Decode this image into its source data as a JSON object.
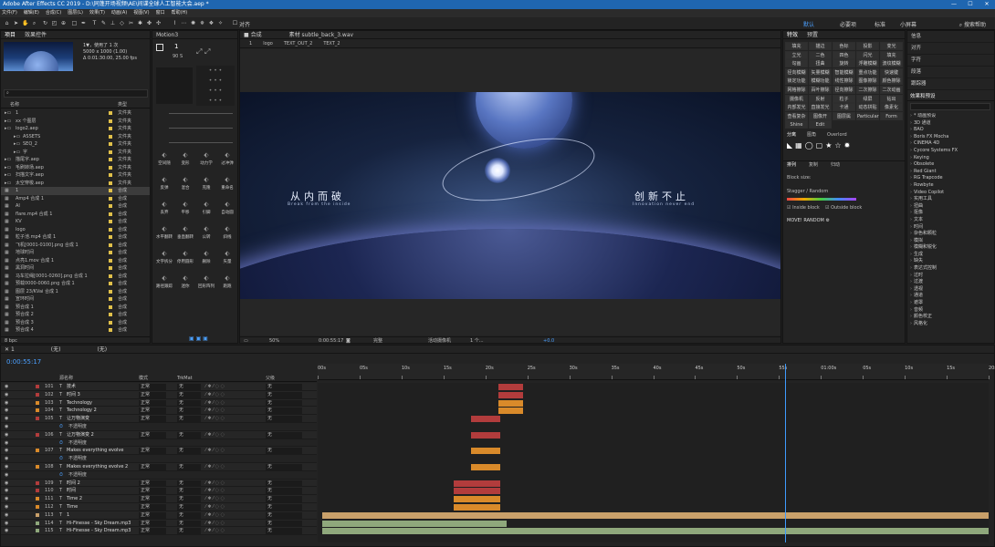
{
  "window": {
    "title": "Adobe After Effects CC 2019 - D:\\同蓬开场视频\\AE\\间谍全球人工智能大会.aep *"
  },
  "menu": [
    "文件(F)",
    "编辑(E)",
    "合成(C)",
    "图层(L)",
    "效果(T)",
    "动画(A)",
    "视图(V)",
    "窗口",
    "帮助(H)"
  ],
  "toolbar": {
    "snap_label": "对齐",
    "workspaces": [
      "默认",
      "必要项",
      "标准",
      "小屏幕"
    ],
    "search": "搜索帮助"
  },
  "project": {
    "tabs": [
      "项目",
      "效果控件"
    ],
    "preview_info": [
      "1▼，使用了 1 次",
      "5000 x 1000 (1.00)",
      "Δ 0:01:30:00, 25.00 fps"
    ],
    "col_name": "名称",
    "col_type": "类型",
    "items": [
      {
        "name": "1",
        "type": "文件夹",
        "color": "#e0c04a"
      },
      {
        "name": "xx 个图层",
        "type": "文件夹",
        "color": "#e0c04a"
      },
      {
        "name": "logo2.aep",
        "type": "文件夹",
        "color": "#e0c04a"
      },
      {
        "name": "ASSETS",
        "type": "文件夹",
        "color": "#e0c04a"
      },
      {
        "name": "SEQ_2",
        "type": "文件夹",
        "color": "#e0c04a"
      },
      {
        "name": "字",
        "type": "文件夹",
        "color": "#e0c04a"
      },
      {
        "name": "描尾字.aep",
        "type": "文件夹",
        "color": "#e0c04a"
      },
      {
        "name": "毛刷转场.aep",
        "type": "文件夹",
        "color": "#e0c04a"
      },
      {
        "name": "扫描文字.aep",
        "type": "文件夹",
        "color": "#e0c04a"
      },
      {
        "name": "太空穿梭.aep",
        "type": "文件夹",
        "color": "#e0c04a"
      },
      {
        "name": "1",
        "type": "合成",
        "color": "#e0c04a"
      },
      {
        "name": "Amp4 合成 1",
        "type": "合成",
        "color": "#e0c04a"
      },
      {
        "name": "AI",
        "type": "合成",
        "color": "#e0c04a"
      },
      {
        "name": "flare.mp4 合成 1",
        "type": "合成",
        "color": "#e0c04a"
      },
      {
        "name": "KV",
        "type": "合成",
        "color": "#e0c04a"
      },
      {
        "name": "logo",
        "type": "合成",
        "color": "#e0c04a"
      },
      {
        "name": "粒子池.mp4 合成 1",
        "type": "合成",
        "color": "#e0c04a"
      },
      {
        "name": "飞机[0001-0100].png 合成 1",
        "type": "合成",
        "color": "#e0c04a"
      },
      {
        "name": "地球时间",
        "type": "合成",
        "color": "#e0c04a"
      },
      {
        "name": "点亮1.mov 合成 1",
        "type": "合成",
        "color": "#e0c04a"
      },
      {
        "name": "黑洞时间",
        "type": "合成",
        "color": "#e0c04a"
      },
      {
        "name": "马车拉绳[0001-0260].png 合成 1",
        "type": "合成",
        "color": "#e0c04a"
      },
      {
        "name": "预载0000-0060.png 合成 1",
        "type": "合成",
        "color": "#e0c04a"
      },
      {
        "name": "图层 23/KVai 合成 1",
        "type": "合成",
        "color": "#e0c04a"
      },
      {
        "name": "宣环时间",
        "type": "合成",
        "color": "#e0c04a"
      },
      {
        "name": "预合成 1",
        "type": "合成",
        "color": "#e0c04a"
      },
      {
        "name": "预合成 2",
        "type": "合成",
        "color": "#e0c04a"
      },
      {
        "name": "预合成 3",
        "type": "合成",
        "color": "#e0c04a"
      },
      {
        "name": "预合成 4",
        "type": "合成",
        "color": "#e0c04a"
      }
    ],
    "bpc": "8 bpc"
  },
  "motion": {
    "tab": "Motion3",
    "value_top": "1",
    "value_sub": "90 S",
    "buttons": [
      "空间随",
      "变形",
      "动力学",
      "过冲弹",
      "反弹",
      "混合",
      "克隆",
      "重命名",
      "丢弃",
      "平移",
      "引脚",
      "自动圆",
      "水平翻转",
      "垂直翻转",
      "公转",
      "斜线",
      "文字拆分",
      "停用圆形",
      "删除",
      "矢量",
      "路径跟踪",
      "迷你",
      "回形阵列",
      "跑跑"
    ]
  },
  "composition": {
    "tab_label": "合成",
    "layer_tab": "素材 subtle_back_3.wav",
    "breadcrumb": [
      "1",
      "logo",
      "TEXT_OUT_2",
      "TEXT_2"
    ],
    "left_title": "从内而破",
    "left_sub": "Break from the inside",
    "right_title": "创新不止",
    "right_sub": "Innovation never end",
    "zoom": "50%",
    "time": "0:00:55:17",
    "quality": "完整",
    "camera": "活动摄像机",
    "views": "1 个...",
    "exposure": "+0.0"
  },
  "presets": {
    "tabs": [
      "特效",
      "预置"
    ],
    "grid": [
      "填充",
      "描边",
      "色标",
      "投影",
      "变光",
      "立光",
      "二色",
      "四色",
      "闪光",
      "填充",
      "勾画",
      "扭曲",
      "旋转",
      "浮雕模糊",
      "波纹模糊",
      "径向模糊",
      "矢量模糊",
      "智能模糊",
      "重点功能",
      "快速键",
      "锁定功能",
      "模糊功能",
      "线性擦除",
      "图像擦除",
      "颜色擦除",
      "网格擦除",
      "百叶擦除",
      "径向擦除",
      "二次擦除",
      "二次动画",
      "摄像机",
      "反射",
      "粒子",
      "绿屏",
      "钻出",
      "内部发光",
      "直接发光",
      "卡通",
      "动态拼贴",
      "像素化",
      "查看复杂",
      "图像开",
      "图层属",
      "Particular",
      "Form",
      "Shine",
      "Edit"
    ],
    "sec2_tabs": [
      "分离",
      "图角",
      "Overlord"
    ],
    "sec3_tabs": [
      "排列",
      "复制",
      "归动"
    ],
    "block_size": "Block size:",
    "stagger": "Stagger / Random",
    "inside_block": "Inside block",
    "outside_block": "Outside block",
    "move_random": "MOVE! RANDOM"
  },
  "right_panel": {
    "items": [
      "信息",
      "对齐",
      "字符",
      "段落",
      "跟踪器"
    ],
    "effects_header": "效果和预设",
    "effects": [
      "* 动画预设",
      "3D 通道",
      "BAO",
      "Boris FX Mocha",
      "CINEMA 4D",
      "Cycore Systems FX",
      "Keying",
      "Obsolete",
      "Red Giant",
      "RG Trapcode",
      "Rowbyte",
      "Video Copilot",
      "实用工具",
      "扭曲",
      "抠像",
      "文本",
      "时间",
      "杂色和颗粒",
      "模拟",
      "模糊和锐化",
      "生成",
      "缺失",
      "表达式控制",
      "过时",
      "过渡",
      "透视",
      "通道",
      "遮罩",
      "音频",
      "颜色校正",
      "风格化"
    ]
  },
  "timeline": {
    "tabs": [
      "1",
      "(无)",
      "(无)"
    ],
    "current_time": "0:00:55:17",
    "col_source": "源名称",
    "col_mode": "模式",
    "col_trkmat": "TrkMat",
    "col_parent": "父级",
    "ruler": [
      "00s",
      "05s",
      "10s",
      "15s",
      "20s",
      "25s",
      "30s",
      "35s",
      "40s",
      "45s",
      "50s",
      "55s",
      "01:00s",
      "05s",
      "10s",
      "15s",
      "20s"
    ],
    "rows": [
      {
        "num": "101",
        "name": "技术",
        "kind": "layer",
        "color": "#b23c3c"
      },
      {
        "num": "102",
        "name": "时间 3",
        "kind": "layer",
        "color": "#b23c3c"
      },
      {
        "num": "103",
        "name": "Technology",
        "kind": "layer",
        "color": "#d98a2a"
      },
      {
        "num": "104",
        "name": "Technology 2",
        "kind": "layer",
        "color": "#d98a2a"
      },
      {
        "num": "105",
        "name": "让万物演变",
        "kind": "layer",
        "color": "#b23c3c"
      },
      {
        "num": "",
        "name": "不透明度",
        "kind": "prop",
        "color": ""
      },
      {
        "num": "106",
        "name": "让万物演变 2",
        "kind": "layer",
        "color": "#b23c3c"
      },
      {
        "num": "",
        "name": "不透明度",
        "kind": "prop",
        "color": ""
      },
      {
        "num": "107",
        "name": "Makes everything evolve",
        "kind": "layer",
        "color": "#d98a2a"
      },
      {
        "num": "",
        "name": "不透明度",
        "kind": "prop",
        "color": ""
      },
      {
        "num": "108",
        "name": "Makes everything evolve 2",
        "kind": "layer",
        "color": "#d98a2a"
      },
      {
        "num": "",
        "name": "不透明度",
        "kind": "prop",
        "color": ""
      },
      {
        "num": "109",
        "name": "时间 2",
        "kind": "layer",
        "color": "#b23c3c"
      },
      {
        "num": "110",
        "name": "时间",
        "kind": "layer",
        "color": "#b23c3c"
      },
      {
        "num": "111",
        "name": "Time 2",
        "kind": "layer",
        "color": "#d98a2a"
      },
      {
        "num": "112",
        "name": "Time",
        "kind": "layer",
        "color": "#d98a2a"
      },
      {
        "num": "113",
        "name": "1",
        "kind": "layer",
        "color": "#c9a06a"
      },
      {
        "num": "114",
        "name": "Hi-Finesse - Sky Dream.mp3",
        "kind": "layer",
        "color": "#8fa87c"
      },
      {
        "num": "115",
        "name": "Hi-Finesse - Sky Dream.mp3",
        "kind": "layer",
        "color": "#8fa87c"
      }
    ],
    "mode_value": "正常",
    "trkmat_value": "无",
    "parent_value": "无",
    "bars": [
      {
        "row": 0,
        "start": 21.5,
        "end": 24.5,
        "color": "#b23c3c"
      },
      {
        "row": 1,
        "start": 21.5,
        "end": 24.5,
        "color": "#b23c3c"
      },
      {
        "row": 2,
        "start": 21.5,
        "end": 24.5,
        "color": "#d98a2a"
      },
      {
        "row": 3,
        "start": 21.5,
        "end": 24.5,
        "color": "#d98a2a"
      },
      {
        "row": 4,
        "start": 18.3,
        "end": 21.8,
        "color": "#b23c3c"
      },
      {
        "row": 6,
        "start": 18.3,
        "end": 21.8,
        "color": "#b23c3c"
      },
      {
        "row": 8,
        "start": 18.3,
        "end": 21.8,
        "color": "#d98a2a"
      },
      {
        "row": 10,
        "start": 18.3,
        "end": 21.8,
        "color": "#d98a2a"
      },
      {
        "row": 12,
        "start": 16.2,
        "end": 21.8,
        "color": "#b23c3c"
      },
      {
        "row": 13,
        "start": 16.2,
        "end": 21.8,
        "color": "#b23c3c"
      },
      {
        "row": 14,
        "start": 16.2,
        "end": 21.8,
        "color": "#d98a2a"
      },
      {
        "row": 15,
        "start": 16.2,
        "end": 21.8,
        "color": "#d98a2a"
      },
      {
        "row": 16,
        "start": 0.5,
        "end": 80,
        "color": "#c9a06a"
      },
      {
        "row": 17,
        "start": 0.5,
        "end": 22.5,
        "color": "#8fa87c"
      },
      {
        "row": 18,
        "start": 0.5,
        "end": 80,
        "color": "#8fa87c"
      }
    ],
    "playhead_seconds": 55.7,
    "ruler_max_seconds": 80
  }
}
